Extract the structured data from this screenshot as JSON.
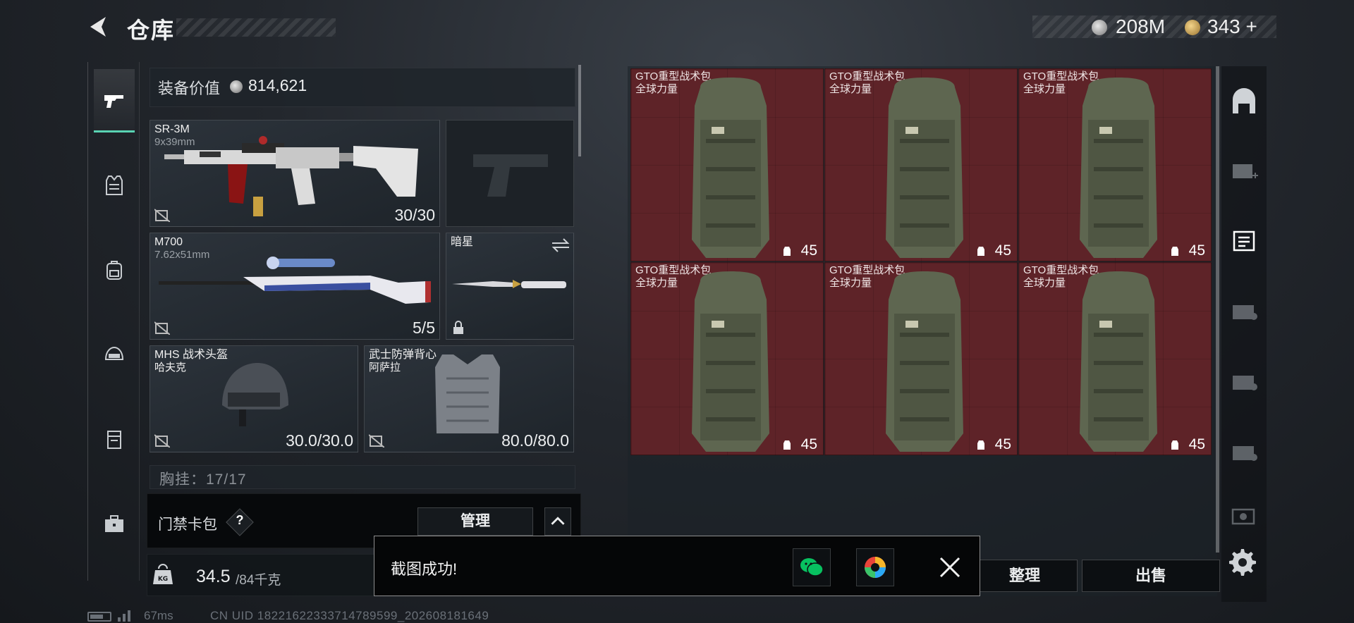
{
  "header": {
    "title": "仓库",
    "currency_primary": "208M",
    "currency_secondary": "343",
    "currency_add": "+"
  },
  "left_nav": {
    "items": [
      {
        "name": "firearm-icon",
        "active": true
      },
      {
        "name": "armor-vest-icon",
        "active": false
      },
      {
        "name": "backpack-icon",
        "active": false
      },
      {
        "name": "helmet-icon",
        "active": false
      },
      {
        "name": "pouch-icon",
        "active": false
      },
      {
        "name": "briefcase-icon",
        "active": false
      }
    ]
  },
  "loadout": {
    "value_label": "装备价值",
    "value": "814,621",
    "primary": {
      "name": "SR-3M",
      "caliber": "9x39mm",
      "durability": "30/30"
    },
    "secondary_empty": true,
    "rifle": {
      "name": "M700",
      "caliber": "7.62x51mm",
      "durability": "5/5"
    },
    "melee": {
      "name": "暗星"
    },
    "helmet": {
      "name": "MHS 战术头盔",
      "brand": "哈夫克",
      "durability": "30.0/30.0"
    },
    "vest": {
      "name": "武士防弹背心",
      "brand": "阿萨拉",
      "durability": "80.0/80.0"
    },
    "pouch_text": "胸挂：17/17"
  },
  "keycard": {
    "label": "门禁卡包",
    "help": "?",
    "manage": "管理"
  },
  "weight": {
    "current": "34.5",
    "max": "/84千克",
    "icon_label": "KG"
  },
  "stash": {
    "items": [
      {
        "name": "GTO重型战术包",
        "brand": "全球力量",
        "capacity": "45"
      },
      {
        "name": "GTO重型战术包",
        "brand": "全球力量",
        "capacity": "45"
      },
      {
        "name": "GTO重型战术包",
        "brand": "全球力量",
        "capacity": "45"
      },
      {
        "name": "GTO重型战术包",
        "brand": "全球力量",
        "capacity": "45"
      },
      {
        "name": "GTO重型战术包",
        "brand": "全球力量",
        "capacity": "45"
      },
      {
        "name": "GTO重型战术包",
        "brand": "全球力量",
        "capacity": "45"
      }
    ],
    "cell_color": "#5e2328"
  },
  "right_tabs": [
    {
      "name": "stash-main-icon"
    },
    {
      "name": "stash-expand-iv-icon"
    },
    {
      "name": "stash-tab-iv-active-icon",
      "active": true
    },
    {
      "name": "stash-tab-iv-icon"
    },
    {
      "name": "stash-tab-iv-icon"
    },
    {
      "name": "stash-tab-iv-icon"
    },
    {
      "name": "stash-tab-v-icon"
    }
  ],
  "actions": {
    "sort": "整理",
    "sell": "出售"
  },
  "toast": {
    "message": "截图成功!"
  },
  "footer": {
    "ping": "67ms",
    "uid": "CN UID 18221622333714789599_202608181649"
  },
  "colors": {
    "accent": "#59d3b3",
    "stash_cell": "#5e2328",
    "wechat": "#07c160"
  }
}
